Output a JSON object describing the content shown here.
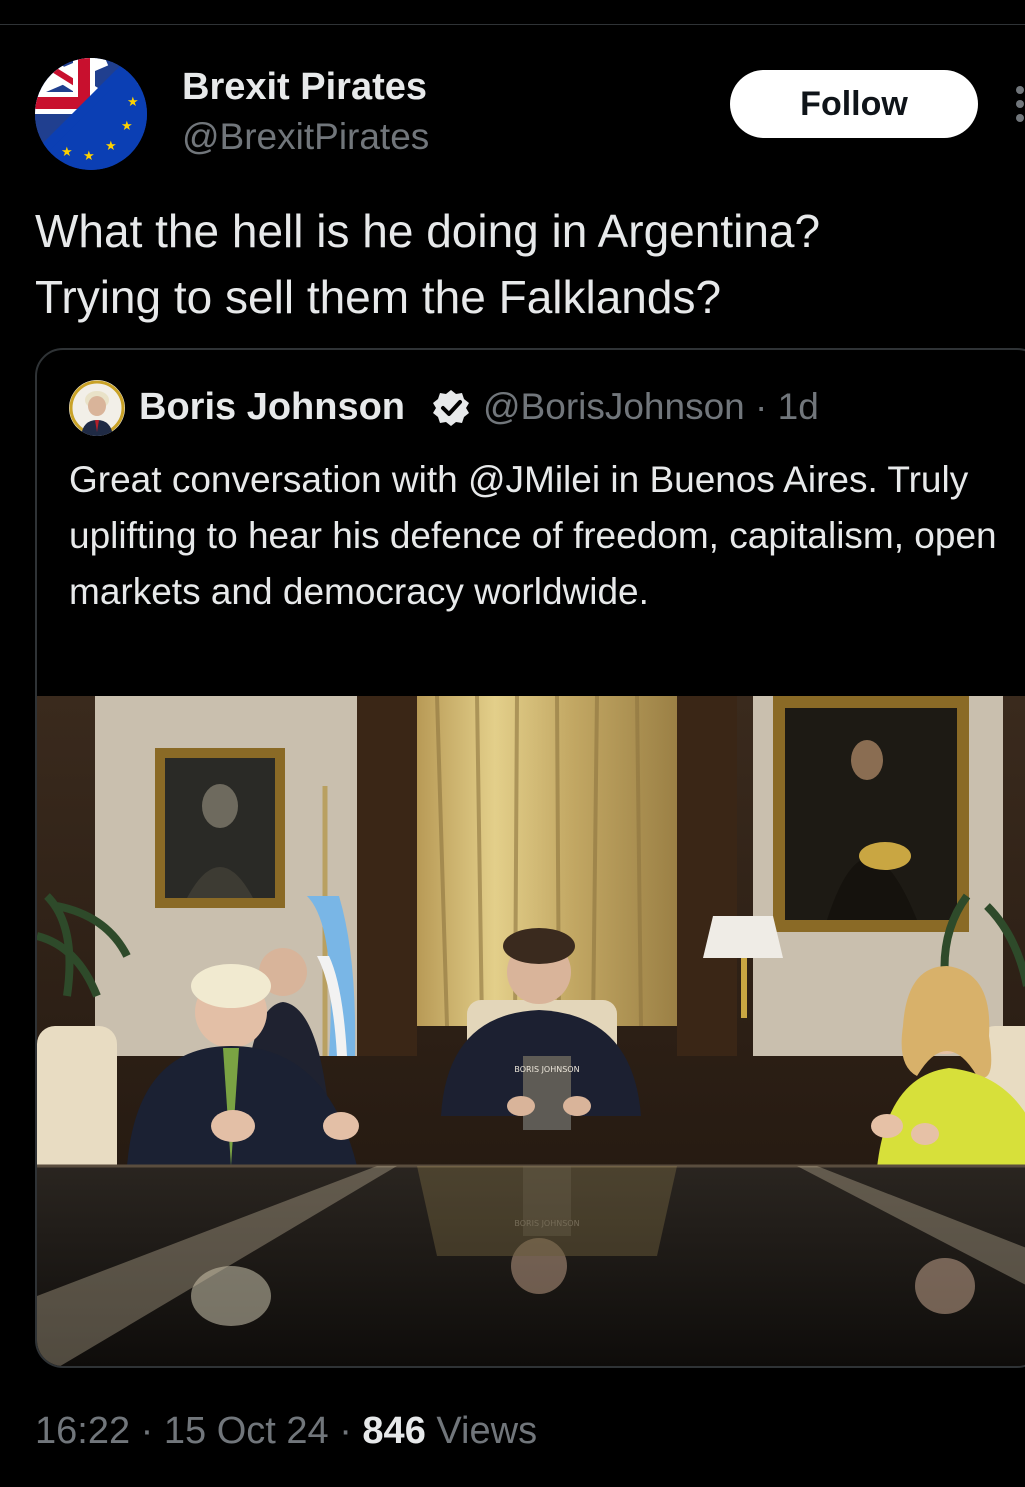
{
  "author": {
    "display_name": "Brexit Pirates",
    "handle": "@BrexitPirates",
    "avatar_icon": "union-jack-eu-flag-avatar"
  },
  "follow_button": {
    "label": "Follow"
  },
  "more_icon": "vertical-ellipsis-icon",
  "tweet": {
    "text": "What the hell is he doing in Argentina?\nTrying to sell them the Falklands?"
  },
  "quoted_tweet": {
    "display_name": "Boris Johnson",
    "handle": "@BorisJohnson",
    "separator": "·",
    "age": "1d",
    "text": "Great conversation with @JMilei in Buenos Aires. Truly uplifting to hear his defence of freedom, capitalism, open markets and democracy worldwide.",
    "verified_icon": "verified-badge-icon",
    "photo": {
      "book_cover_text": "BORIS JOHNSON",
      "book_reflection_text": "BORIS JOHNSON"
    }
  },
  "footer": {
    "time": "16:22",
    "separator1": " · ",
    "date": "15 Oct 24",
    "separator2": " · ",
    "views_count": "846",
    "views_label": " Views"
  },
  "colors": {
    "background": "#000000",
    "text_primary": "#e7e9ea",
    "text_secondary": "#71767b",
    "border": "#2f3336",
    "verified": "#1d9bf0"
  }
}
